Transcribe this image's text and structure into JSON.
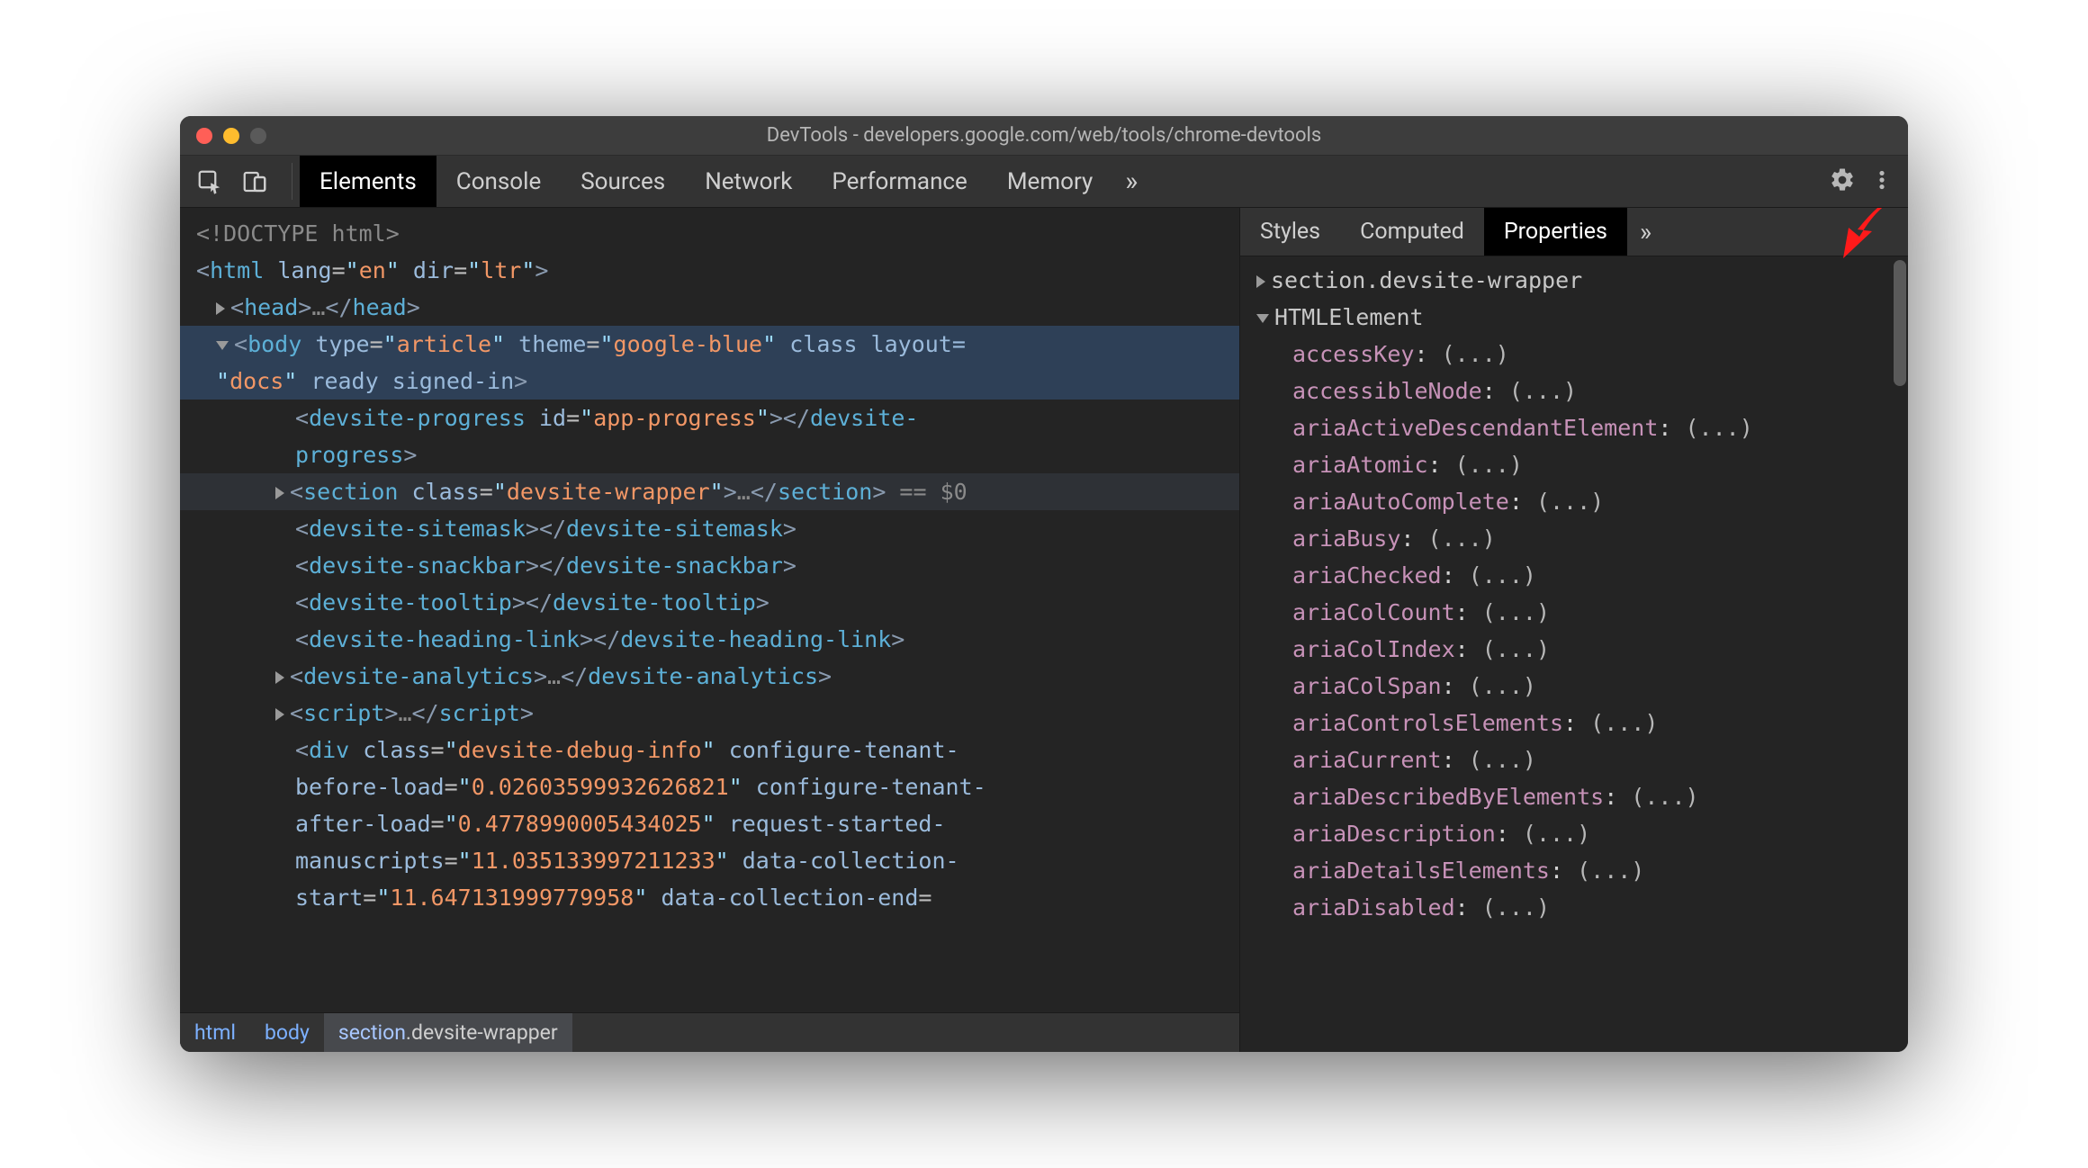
{
  "window": {
    "title": "DevTools - developers.google.com/web/tools/chrome-devtools"
  },
  "mainTabs": {
    "items": [
      "Elements",
      "Console",
      "Sources",
      "Network",
      "Performance",
      "Memory"
    ],
    "activeIndex": 0,
    "more": "»"
  },
  "dom": {
    "doctype": "<!DOCTYPE html>",
    "htmlOpen": {
      "tag": "html",
      "attrs": [
        [
          "lang",
          "en"
        ],
        [
          "dir",
          "ltr"
        ]
      ]
    },
    "head": {
      "tag": "head",
      "ellipsis": "…"
    },
    "bodyOpen": {
      "tag": "body",
      "attrs": [
        [
          "type",
          "article"
        ],
        [
          "theme",
          "google-blue"
        ]
      ],
      "flagsLine1": "class layout=",
      "val2": "docs",
      "flagsLine2": " ready signed-in"
    },
    "progress": {
      "tag": "devsite-progress",
      "attrs": [
        [
          "id",
          "app-progress"
        ]
      ]
    },
    "section": {
      "tag": "section",
      "attrs": [
        [
          "class",
          "devsite-wrapper"
        ]
      ],
      "ellipsis": "…",
      "suffix": " == $0"
    },
    "sitemask": "devsite-sitemask",
    "snackbar": "devsite-snackbar",
    "tooltip": "devsite-tooltip",
    "headingLink": "devsite-heading-link",
    "analytics": {
      "tag": "devsite-analytics",
      "ellipsis": "…"
    },
    "script": {
      "tag": "script",
      "ellipsis": "…"
    },
    "debugDiv": {
      "tag": "div",
      "classVal": "devsite-debug-info",
      "attrs": [
        [
          "configure-tenant-before-load",
          "0.02603599932626821"
        ],
        [
          "configure-tenant-after-load",
          "0.4778990005434025"
        ],
        [
          "request-started-manuscripts",
          "11.035133997211233"
        ],
        [
          "data-collection-start",
          "11.647131999779958"
        ],
        [
          "data-collection-end",
          ""
        ]
      ]
    },
    "gutterEllipsis": "•••"
  },
  "breadcrumbs": {
    "items": [
      {
        "label": "html",
        "cls": ""
      },
      {
        "label": "body",
        "cls": ""
      },
      {
        "label": "section",
        "cls": ".devsite-wrapper"
      }
    ],
    "activeIndex": 2
  },
  "sideTabs": {
    "items": [
      "Styles",
      "Computed",
      "Properties"
    ],
    "activeIndex": 2,
    "more": "»"
  },
  "properties": {
    "header": "section.devsite-wrapper",
    "proto": "HTMLElement",
    "entries": [
      "accessKey",
      "accessibleNode",
      "ariaActiveDescendantElement",
      "ariaAtomic",
      "ariaAutoComplete",
      "ariaBusy",
      "ariaChecked",
      "ariaColCount",
      "ariaColIndex",
      "ariaColSpan",
      "ariaControlsElements",
      "ariaCurrent",
      "ariaDescribedByElements",
      "ariaDescription",
      "ariaDetailsElements",
      "ariaDisabled"
    ],
    "valuePlaceholder": "(...)"
  }
}
